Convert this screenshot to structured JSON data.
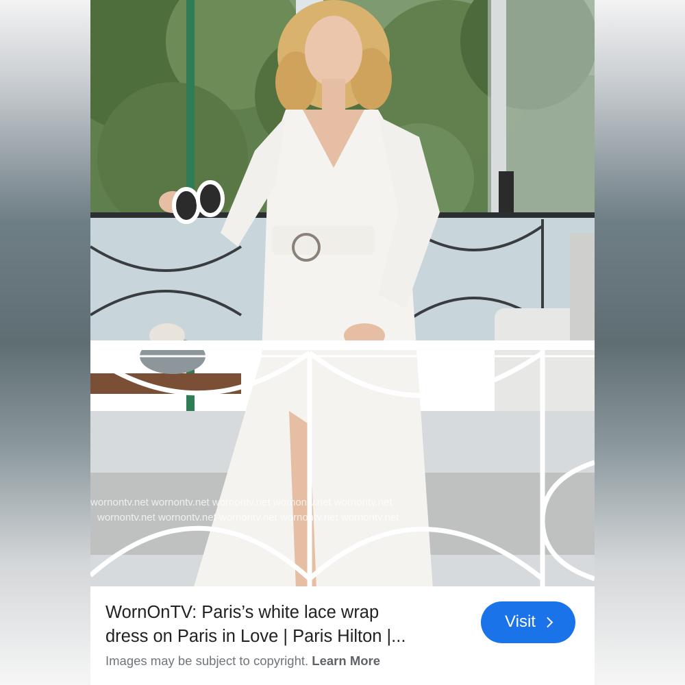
{
  "result": {
    "title_line1": "WornOnTV: Paris’s white lace wrap",
    "title_line2": "dress on Paris in Love | Paris Hilton |...",
    "visit_label": "Visit",
    "visit_icon": "chevron-right-icon",
    "copyright_text": "Images may be subject to copyright.",
    "learn_more_label": "Learn More"
  },
  "photo": {
    "watermark_row1": "wornontv.net   wornontv.net   wornontv.net   wornontv.net   wornontv.net",
    "watermark_row2": "wornontv.net   wornontv.net   wornontv.net   wornontv.net   wornontv.net"
  },
  "colors": {
    "accent": "#1a73e8",
    "title_text": "#202124",
    "secondary_text": "#70757a"
  }
}
